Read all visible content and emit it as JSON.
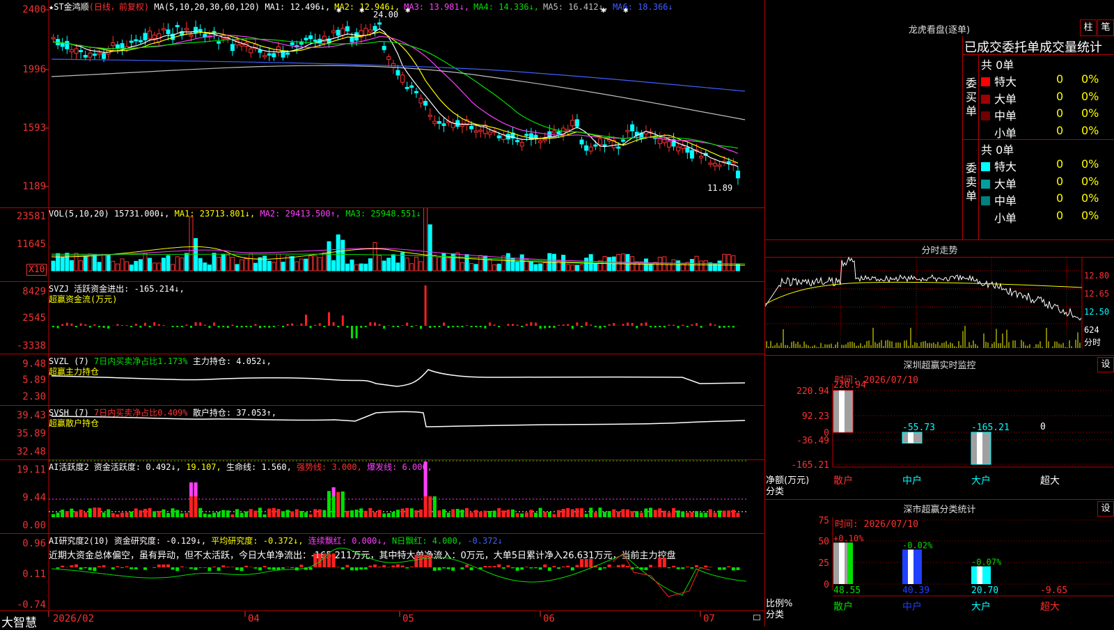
{
  "main": {
    "title": "★ST金鸿顺",
    "period": "(日线，前复权)",
    "ma_label": "MA(5,10,20,30,60,120)",
    "ma_values": [
      {
        "name": "MA1:",
        "value": "12.496↓,",
        "color": "#ffffff"
      },
      {
        "name": "MA2:",
        "value": "12.946↓,",
        "color": "#ffff00"
      },
      {
        "name": "MA3:",
        "value": "13.981↓,",
        "color": "#ff40ff"
      },
      {
        "name": "MA4:",
        "value": "14.336↓,",
        "color": "#00e000"
      },
      {
        "name": "MA5:",
        "value": "16.412↓,",
        "color": "#c0c0c0"
      },
      {
        "name": "MA6:",
        "value": "18.366↓",
        "color": "#4060ff"
      }
    ],
    "y_ticks": [
      "2400",
      "1996",
      "1593",
      "1189"
    ],
    "high_label": "24.00",
    "low_label": "11.89"
  },
  "vol": {
    "label": "VOL(5,10,20)",
    "value": "15731.000↓,",
    "ma1": "MA1: 23713.801↓,",
    "ma2": "MA2: 29413.500↑,",
    "ma3": "MA3: 25948.551↓",
    "y_ticks": [
      "23581",
      "11645"
    ],
    "unit": "X10"
  },
  "svzj": {
    "line": "SVZJ  活跃资金进出: -165.214↓,",
    "sub": "超赢资金流(万元)",
    "y_ticks": [
      "8429",
      "2545",
      "-3338"
    ]
  },
  "svzl": {
    "name": "SVZL (7)",
    "part1": "7日内买卖净占比1.173%",
    "part2": "主力持仓: 4.052↓,",
    "sub": "超赢主力持仓",
    "y_ticks": [
      "9.48",
      "5.89",
      "2.30"
    ]
  },
  "svsh": {
    "name": "SVSH (7)",
    "part1": "7日内买卖净占比0.409%",
    "part2": "散户持仓: 37.053↑,",
    "sub": "超赢散户持仓",
    "y_ticks": [
      "39.43",
      "35.89",
      "32.48"
    ]
  },
  "ai_active": {
    "name": "AI活跃度2",
    "v1": "资金活跃度: 0.492↓,",
    "v2": "19.107,",
    "v3": "生命线: 1.560,",
    "v4": "强势线: 3.000,",
    "v5": "爆发线: 6.000,",
    "y_ticks": [
      "19.11",
      "9.44",
      "0.00"
    ]
  },
  "ai_research": {
    "name": "AI研究度2(10)",
    "v1": "资金研究度: -0.129↓,",
    "v2": "平均研究度: -0.372↓,",
    "v3": "连续飘红: 0.000↓,",
    "v4": "N日飘红: 4.000,",
    "v5": "-0.372↓",
    "summary": "近期大资金总体偏空，虽有异动，但不太活跃，今日大单净流出：-165.211万元，其中特大单净流入：0万元，大单5日累计净入26.631万元，当前主力控盘",
    "y_ticks": [
      "0.96",
      "0.11",
      "-0.74"
    ]
  },
  "xaxis": {
    "brand": "大智慧",
    "labels": [
      "2026/02",
      "04",
      "05",
      "06",
      "07"
    ]
  },
  "longhu": {
    "title": "龙虎看盘(逐单)",
    "btn_bar": "柱",
    "btn_pen": "笔",
    "header": "已成交委托单成交量统计",
    "buy_label": "委买单",
    "sell_label": "委卖单",
    "buy_total": "共 0单",
    "sell_total": "共 0单",
    "buy_rows": [
      {
        "name": "特大",
        "count": "0",
        "pct": "0%",
        "color": "#ff0000"
      },
      {
        "name": "大单",
        "count": "0",
        "pct": "0%",
        "color": "#a00000"
      },
      {
        "name": "中单",
        "count": "0",
        "pct": "0%",
        "color": "#700000"
      },
      {
        "name": "小单",
        "count": "0",
        "pct": "0%",
        "color": "#000000"
      }
    ],
    "sell_rows": [
      {
        "name": "特大",
        "count": "0",
        "pct": "0%",
        "color": "#00ffff"
      },
      {
        "name": "大单",
        "count": "0",
        "pct": "0%",
        "color": "#00a0a0"
      },
      {
        "name": "中单",
        "count": "0",
        "pct": "0%",
        "color": "#008080"
      },
      {
        "name": "小单",
        "count": "0",
        "pct": "0%",
        "color": "#000000"
      }
    ]
  },
  "intraday": {
    "title": "分时走势",
    "y_ticks": [
      "12.80",
      "12.65",
      "12.50"
    ],
    "vol_tick": "624",
    "unit": "分时"
  },
  "sz_monitor": {
    "title": "深圳超赢实时监控",
    "btn": "设",
    "time": "时间: 2026/07/10",
    "y_ticks": [
      "220.94",
      "92.23",
      "0",
      "-36.49",
      "-165.21"
    ],
    "unit": "净额(万元)",
    "category_label": "分类",
    "categories": [
      "散户",
      "中户",
      "大户",
      "超大"
    ],
    "values": [
      220.94,
      -55.73,
      -165.21,
      0
    ],
    "value_labels": [
      "220.94",
      "-55.73",
      "-165.21",
      "0"
    ]
  },
  "sz_class": {
    "title": "深市超赢分类统计",
    "btn": "设",
    "time": "时间: 2026/07/10",
    "y_ticks": [
      "75",
      "50",
      "25",
      "0"
    ],
    "unit": "比例%",
    "category_label": "分类",
    "categories": [
      "散户",
      "中户",
      "大户",
      "超大"
    ],
    "values": [
      48.55,
      40.39,
      20.7,
      -9.65
    ],
    "value_labels": [
      "48.55",
      "40.39",
      "20.70",
      "-9.65"
    ],
    "change_labels": [
      "+0.10%",
      "-0.02%",
      "-0.07%",
      ""
    ]
  }
}
